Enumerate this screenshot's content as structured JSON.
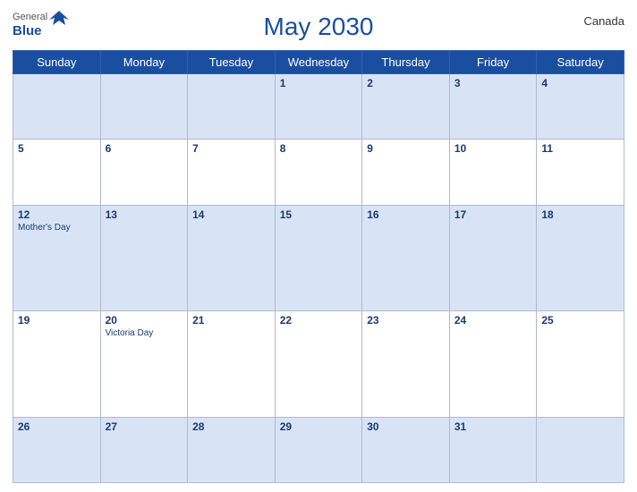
{
  "header": {
    "title": "May 2030",
    "country": "Canada",
    "logo": {
      "general": "General",
      "blue": "Blue"
    }
  },
  "weekdays": [
    "Sunday",
    "Monday",
    "Tuesday",
    "Wednesday",
    "Thursday",
    "Friday",
    "Saturday"
  ],
  "weeks": [
    [
      {
        "day": "",
        "holiday": ""
      },
      {
        "day": "",
        "holiday": ""
      },
      {
        "day": "",
        "holiday": ""
      },
      {
        "day": "1",
        "holiday": ""
      },
      {
        "day": "2",
        "holiday": ""
      },
      {
        "day": "3",
        "holiday": ""
      },
      {
        "day": "4",
        "holiday": ""
      }
    ],
    [
      {
        "day": "5",
        "holiday": ""
      },
      {
        "day": "6",
        "holiday": ""
      },
      {
        "day": "7",
        "holiday": ""
      },
      {
        "day": "8",
        "holiday": ""
      },
      {
        "day": "9",
        "holiday": ""
      },
      {
        "day": "10",
        "holiday": ""
      },
      {
        "day": "11",
        "holiday": ""
      }
    ],
    [
      {
        "day": "12",
        "holiday": "Mother's Day"
      },
      {
        "day": "13",
        "holiday": ""
      },
      {
        "day": "14",
        "holiday": ""
      },
      {
        "day": "15",
        "holiday": ""
      },
      {
        "day": "16",
        "holiday": ""
      },
      {
        "day": "17",
        "holiday": ""
      },
      {
        "day": "18",
        "holiday": ""
      }
    ],
    [
      {
        "day": "19",
        "holiday": ""
      },
      {
        "day": "20",
        "holiday": "Victoria Day"
      },
      {
        "day": "21",
        "holiday": ""
      },
      {
        "day": "22",
        "holiday": ""
      },
      {
        "day": "23",
        "holiday": ""
      },
      {
        "day": "24",
        "holiday": ""
      },
      {
        "day": "25",
        "holiday": ""
      }
    ],
    [
      {
        "day": "26",
        "holiday": ""
      },
      {
        "day": "27",
        "holiday": ""
      },
      {
        "day": "28",
        "holiday": ""
      },
      {
        "day": "29",
        "holiday": ""
      },
      {
        "day": "30",
        "holiday": ""
      },
      {
        "day": "31",
        "holiday": ""
      },
      {
        "day": "",
        "holiday": ""
      }
    ]
  ],
  "colors": {
    "header_bg": "#1a4fa0",
    "odd_row": "#d8e4f5",
    "even_row": "#ffffff",
    "text_blue": "#1a4fa0"
  }
}
